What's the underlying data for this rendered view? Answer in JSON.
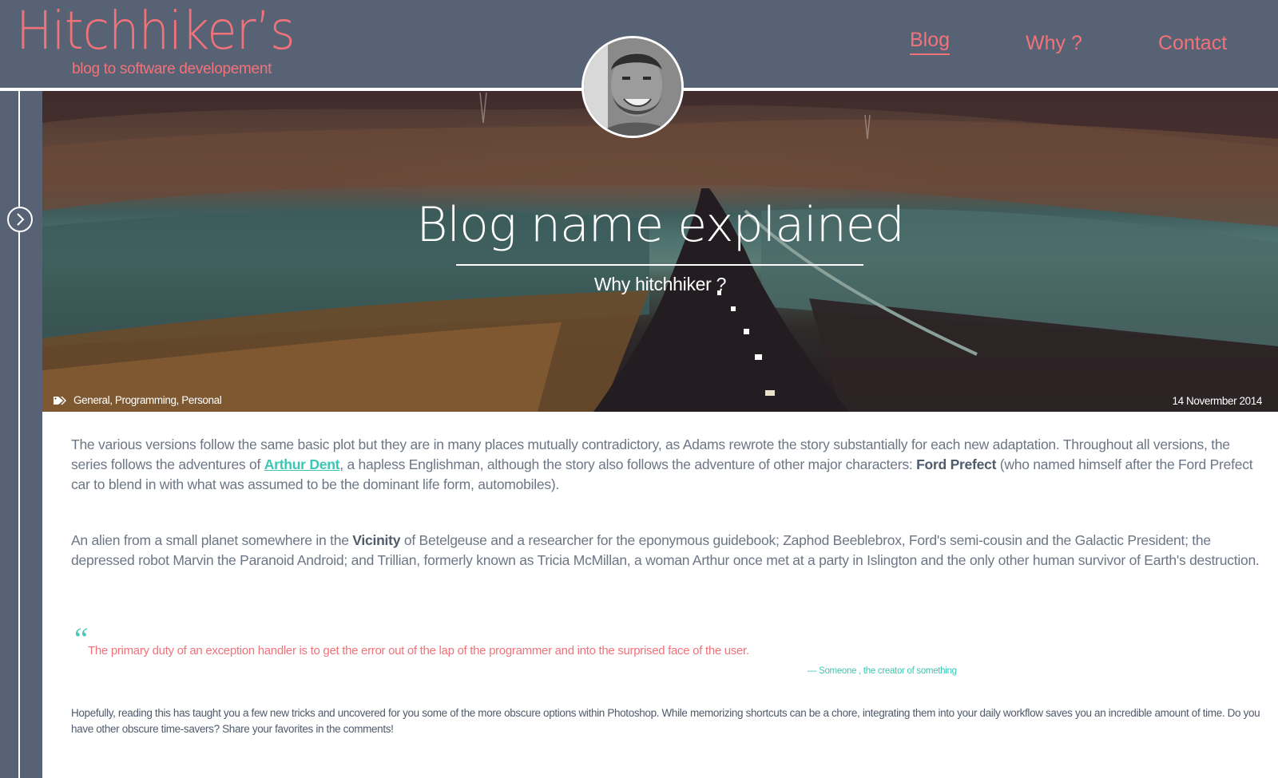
{
  "brand": {
    "title": "Hitchhiker’s",
    "tagline": "blog to software developement",
    "accent_color": "#f2727a",
    "header_color": "#576374",
    "link_color": "#3cc6b3"
  },
  "nav": {
    "items": [
      {
        "label": "Blog",
        "active": true
      },
      {
        "label": "Why ?",
        "active": false
      },
      {
        "label": "Contact",
        "active": false
      }
    ]
  },
  "sidebar": {
    "toggle_icon": "chevron-right-icon"
  },
  "avatar": {
    "icon": "author-avatar"
  },
  "hero": {
    "title": "Blog name explained",
    "subtitle": "Why hitchhiker ?",
    "tags_icon": "tags-icon",
    "tags": "General, Programming, Personal",
    "date": "14 Novermber 2014"
  },
  "article": {
    "p1": {
      "before_link": "The various versions follow the same basic plot but they are in many places mutually contradictory, as Adams rewrote the story substantially for each new adaptation. Throughout all versions, the series follows the adventures of ",
      "link": "Arthur Dent",
      "after_link": ", a hapless Englishman, although the story also follows the adventure of other major characters: ",
      "bold": "Ford Prefect",
      "end": " (who named himself after the Ford Prefect car to blend in with what was assumed to be the dominant life form, automobiles)."
    },
    "p2": {
      "before_bold": "An alien from a small planet somewhere in the ",
      "bold": "Vicinity",
      "end": " of Betelgeuse and a researcher for the eponymous guidebook; Zaphod Beeblebrox, Ford's semi-cousin and the Galactic President; the depressed robot Marvin the Paranoid Android; and Trillian, formerly known as Tricia McMillan, a woman Arthur once met at a party in Islington and the only other human survivor of Earth's destruction."
    },
    "quote": {
      "mark": "“",
      "text": "The primary duty of an exception handler is to get the error out of the lap of the programmer and into the surprised face of the user.",
      "cite": "— Someone , the creator of something"
    },
    "p3": "Hopefully, reading this has taught you a few new tricks and uncovered for you some of the more obscure options within Photoshop. While memorizing shortcuts can be a chore, integrating them into your daily workflow saves you an incredible amount of time. Do you have other obscure time-savers? Share your favorites in the comments!"
  }
}
